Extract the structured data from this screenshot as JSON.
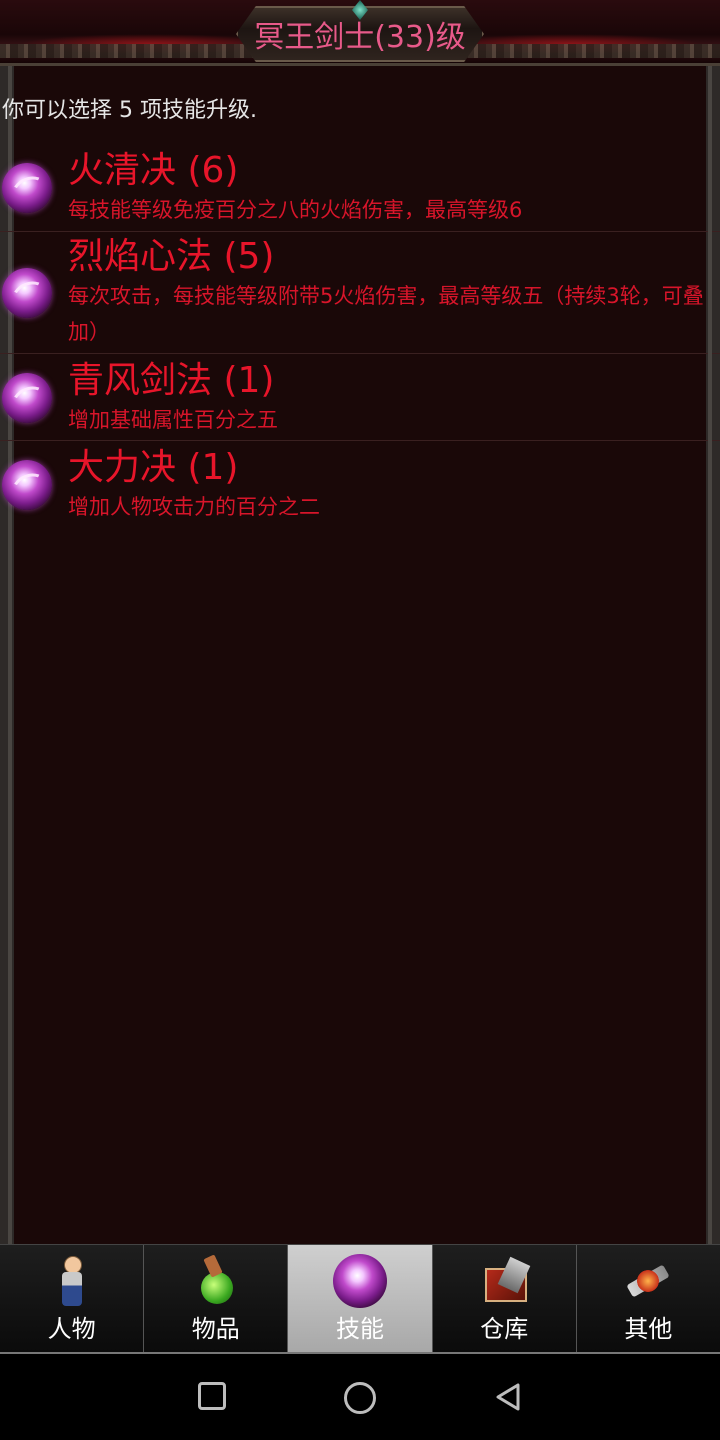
{
  "header": {
    "title": "冥王剑士(33)级"
  },
  "hint": "你可以选择 5 项技能升级.",
  "skills": [
    {
      "name": "火清决 (6)",
      "desc": "每技能等级免疫百分之八的火焰伤害，最高等级6",
      "icon": "skill-orb-icon"
    },
    {
      "name": "烈焰心法 (5)",
      "desc": "每次攻击，每技能等级附带5火焰伤害，最高等级五（持续3轮，可叠加）",
      "icon": "skill-orb-icon"
    },
    {
      "name": "青风剑法 (1)",
      "desc": "增加基础属性百分之五",
      "icon": "skill-orb-icon"
    },
    {
      "name": "大力决 (1)",
      "desc": "增加人物攻击力的百分之二",
      "icon": "skill-orb-icon"
    }
  ],
  "tabs": [
    {
      "label": "人物",
      "icon": "character-icon",
      "active": false
    },
    {
      "label": "物品",
      "icon": "potion-icon",
      "active": false
    },
    {
      "label": "技能",
      "icon": "skill-orb-icon",
      "active": true
    },
    {
      "label": "仓库",
      "icon": "storage-icon",
      "active": false
    },
    {
      "label": "其他",
      "icon": "other-icon",
      "active": false
    }
  ],
  "colors": {
    "title": "#e85a8a",
    "skill_text": "#e8152a",
    "panel_bg": "#1a0808",
    "active_tab": "#bdbdbd"
  },
  "nav": {
    "buttons": [
      "recents-icon",
      "home-icon",
      "back-icon"
    ]
  }
}
